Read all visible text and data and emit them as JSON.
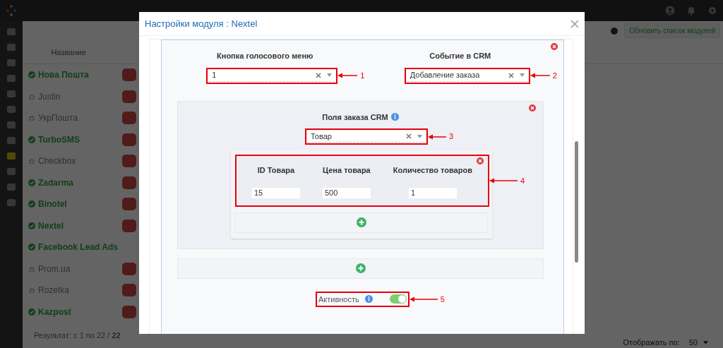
{
  "app": {
    "toolbar": {
      "refresh_button": "Обновить список модулей"
    },
    "table": {
      "columns": [
        "Название"
      ],
      "rows": [
        {
          "name": "Нова Пошта",
          "active": true,
          "logo": true
        },
        {
          "name": "Justin",
          "active": false,
          "logo": true
        },
        {
          "name": "УкрПошта",
          "active": false,
          "logo": true
        },
        {
          "name": "TurboSMS",
          "active": true,
          "logo": true
        },
        {
          "name": "Checkbox",
          "active": false,
          "logo": true
        },
        {
          "name": "Zadarma",
          "active": true,
          "logo": true
        },
        {
          "name": "Binotel",
          "active": true,
          "logo": true
        },
        {
          "name": "Nextel",
          "active": true,
          "logo": true
        },
        {
          "name": "Facebook Lead Ads",
          "active": true,
          "logo": false
        },
        {
          "name": "Prom.ua",
          "active": false,
          "logo": true
        },
        {
          "name": "Rozetka",
          "active": false,
          "logo": true
        },
        {
          "name": "Kazpost",
          "active": true,
          "logo": true
        }
      ]
    },
    "footer": {
      "result": "Результат:  с 1 по 22 / **22**",
      "per_page_label": "Отображать по:",
      "per_page": "50"
    }
  },
  "modal": {
    "title": "Настройки модуля : Nextel",
    "voice_button": {
      "label": "Кнопка голосового меню",
      "value": "1",
      "callout": "1"
    },
    "crm_event": {
      "label": "Событие в CRM",
      "value": "Добавление заказа",
      "callout": "2"
    },
    "order_fields": {
      "label": "Поля заказа CRM",
      "value": "Товар",
      "callout": "3",
      "params_callout": "4",
      "params": [
        {
          "label": "ID Товара",
          "value": "15"
        },
        {
          "label": "Цена товара",
          "value": "500"
        },
        {
          "label": "Количество товаров",
          "value": "1"
        }
      ]
    },
    "active": {
      "label": "Активность",
      "on": true,
      "callout": "5"
    }
  }
}
